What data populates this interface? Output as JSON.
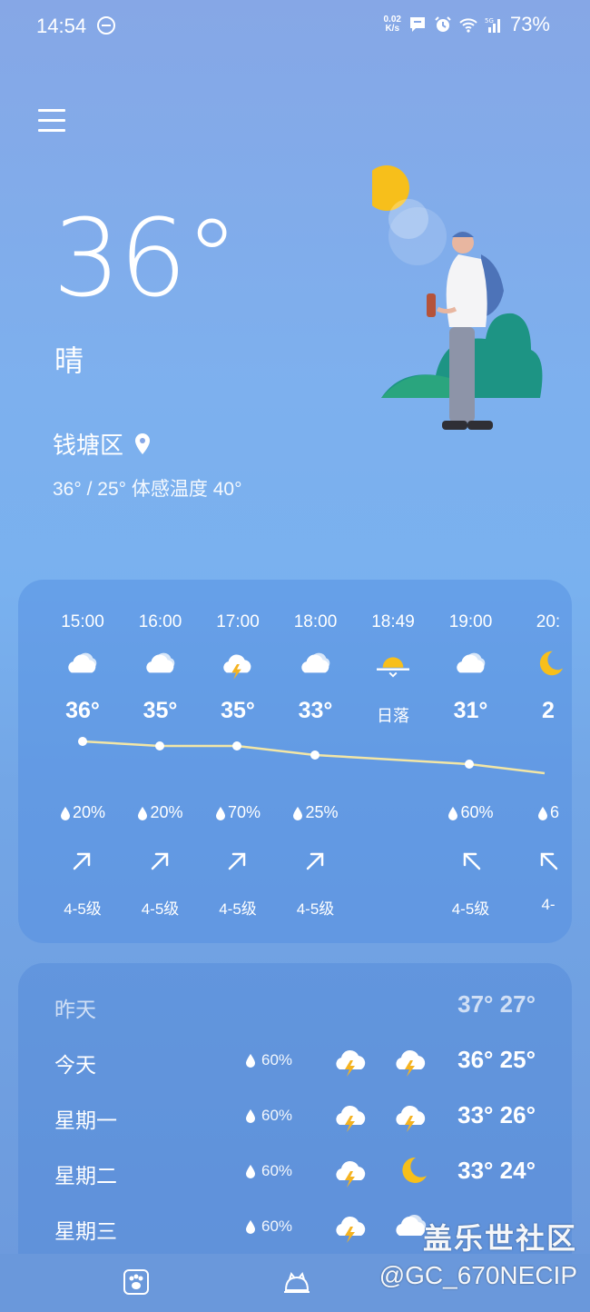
{
  "status_bar": {
    "time": "14:54",
    "net_speed_value": "0.02",
    "net_speed_unit": "K/s",
    "battery": "73%"
  },
  "current": {
    "temperature": "36°",
    "condition": "晴",
    "location": "钱塘区",
    "range_text": "36° / 25°",
    "feels_like": "体感温度 40°"
  },
  "hourly": [
    {
      "time": "15:00",
      "icon": "cloudy-icon",
      "temp": "36°",
      "rain": "20%",
      "wind": "4-5级",
      "wind_dir": "ne"
    },
    {
      "time": "16:00",
      "icon": "cloudy-icon",
      "temp": "35°",
      "rain": "20%",
      "wind": "4-5级",
      "wind_dir": "ne"
    },
    {
      "time": "17:00",
      "icon": "thunder-icon",
      "temp": "35°",
      "rain": "70%",
      "wind": "4-5级",
      "wind_dir": "ne"
    },
    {
      "time": "18:00",
      "icon": "cloudy-icon",
      "temp": "33°",
      "rain": "25%",
      "wind": "4-5级",
      "wind_dir": "ne"
    },
    {
      "time": "18:49",
      "icon": "sunset-icon",
      "temp": "日落",
      "rain": "",
      "wind": "",
      "wind_dir": ""
    },
    {
      "time": "19:00",
      "icon": "cloudy-icon",
      "temp": "31°",
      "rain": "60%",
      "wind": "4-5级",
      "wind_dir": "nw"
    },
    {
      "time": "20:",
      "icon": "moon-icon",
      "temp": "2",
      "rain": "6",
      "wind": "4-",
      "wind_dir": "nw"
    }
  ],
  "daily": [
    {
      "day": "昨天",
      "rain": "",
      "temps": "37° 27°",
      "icon1": "",
      "icon2": ""
    },
    {
      "day": "今天",
      "rain": "60%",
      "temps": "36° 25°",
      "icon1": "thunder-icon",
      "icon2": "thunder-icon"
    },
    {
      "day": "星期一",
      "rain": "60%",
      "temps": "33° 26°",
      "icon1": "thunder-icon",
      "icon2": "thunder-icon"
    },
    {
      "day": "星期二",
      "rain": "60%",
      "temps": "33° 24°",
      "icon1": "thunder-icon",
      "icon2": "moon-icon"
    },
    {
      "day": "星期三",
      "rain": "60%",
      "temps": "",
      "icon1": "thunder-icon",
      "icon2": "cloudy-icon"
    }
  ],
  "watermark": {
    "title": "盖乐世社区",
    "user": "@GC_670NECIP"
  },
  "colors": {
    "sun": "#f7bf1b",
    "bolt": "#f5b320",
    "curve": "#f2e6a6"
  }
}
